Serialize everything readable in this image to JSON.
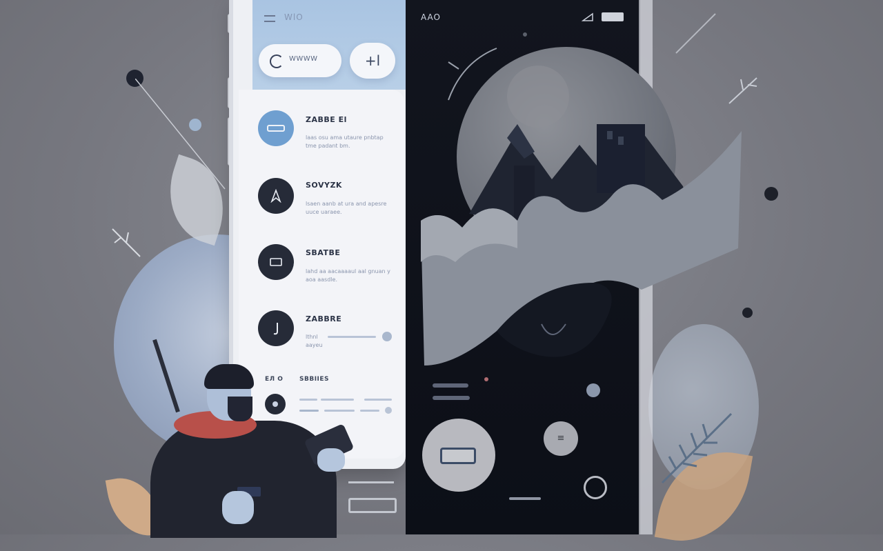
{
  "light_screen": {
    "title": "WlO",
    "search_label": "WWWW",
    "add_label": "+l",
    "items": [
      {
        "title": "ZABBE El",
        "sub": "laas osu ama utaure pnbtap tme padant bm."
      },
      {
        "title": "SOVYZK",
        "sub": "lsaen aanb at ura and apesre uuce uaraee."
      },
      {
        "title": "SBATBE",
        "sub": "lahd aa aacaaaaul aal gnuan y aoa aasdle."
      },
      {
        "title": "ZABBRE",
        "sub": "lthnl aayeu"
      }
    ],
    "footer_left": "ЕЛ О",
    "footer_right": "SBBIIES"
  },
  "dark_screen": {
    "title": "AAO",
    "mid_button_icon": "equals-icon"
  },
  "colors": {
    "accent_blue": "#6f9fd0",
    "dark_bg": "#0f121a",
    "light_bg": "#eef0f4"
  }
}
